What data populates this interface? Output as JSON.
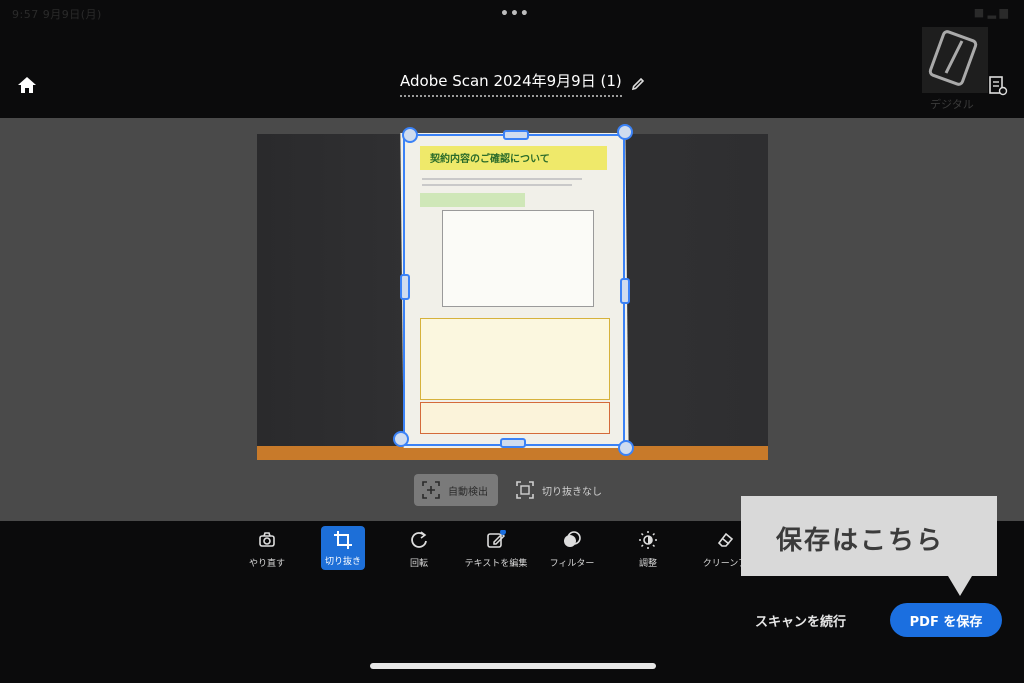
{
  "header": {
    "title": "Adobe Scan 2024年9月9日 (1)"
  },
  "status": {
    "time": "9:57 9月9日(月)",
    "battery": "■ ▂ ▆",
    "dots": "•••"
  },
  "thumbnail": {
    "label": "デジタル"
  },
  "document": {
    "heading": "契約内容のご確認について"
  },
  "crop_modes": {
    "auto_detect": "自動検出",
    "no_crop": "切り抜きなし"
  },
  "toolbar": {
    "items": [
      {
        "label": "やり直す",
        "icon": "retake-icon"
      },
      {
        "label": "切り抜き",
        "icon": "crop-icon"
      },
      {
        "label": "回転",
        "icon": "rotate-icon"
      },
      {
        "label": "テキストを編集",
        "icon": "edit-text-icon"
      },
      {
        "label": "フィルター",
        "icon": "filter-icon"
      },
      {
        "label": "調整",
        "icon": "adjust-icon"
      },
      {
        "label": "クリーンア",
        "icon": "eraser-icon"
      }
    ]
  },
  "callout": {
    "text": "保存はこちら"
  },
  "actions": {
    "continue": "スキャンを続行",
    "save_pdf": "PDF を保存"
  },
  "colors": {
    "accent": "#1b6fe0",
    "crop_frame": "#3b82f6",
    "background": "#0b0b0c",
    "workarea": "#4a4a4a"
  }
}
